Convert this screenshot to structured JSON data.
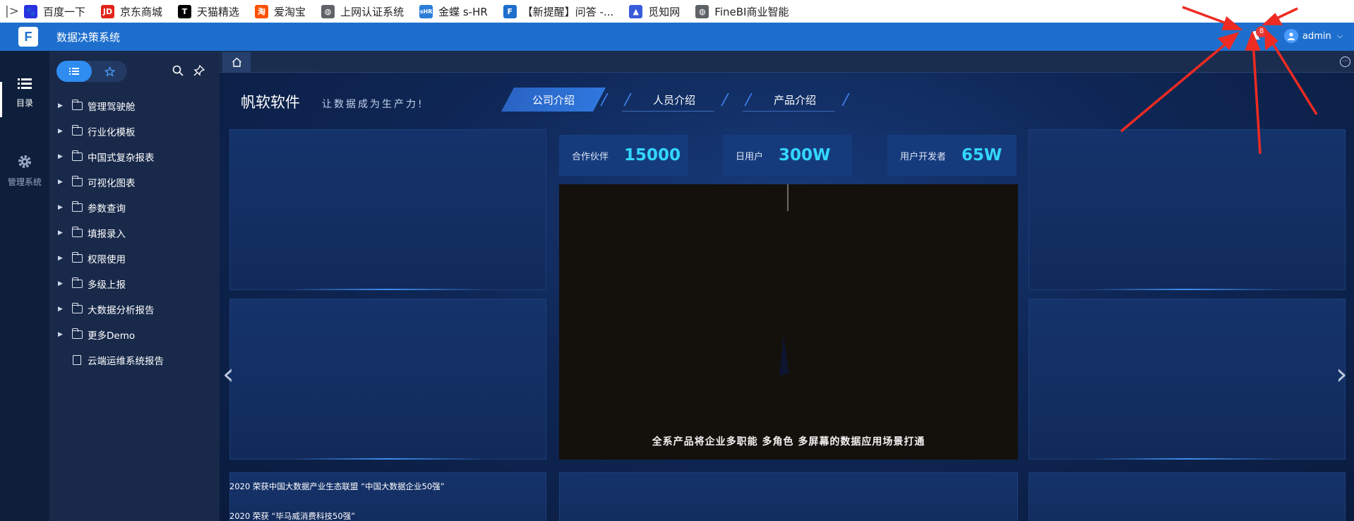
{
  "bookmarks": [
    {
      "label": "百度一下",
      "icon": "baidu-paw-icon",
      "color": "#2932e1",
      "glyph": "🐾"
    },
    {
      "label": "京东商城",
      "icon": "jd-icon",
      "color": "#e1251b",
      "glyph": "JD"
    },
    {
      "label": "天猫精选",
      "icon": "tmall-icon",
      "color": "#000000",
      "glyph": "T"
    },
    {
      "label": "爱淘宝",
      "icon": "taobao-icon",
      "color": "#ff5000",
      "glyph": "淘"
    },
    {
      "label": "上网认证系统",
      "icon": "globe-icon",
      "color": "#5f6368",
      "glyph": "◍"
    },
    {
      "label": "金蝶 s-HR",
      "icon": "kingdee-shr-icon",
      "color": "#2b7dd8",
      "glyph": "sHR"
    },
    {
      "label": "【新提醒】问答 -...",
      "icon": "fanruan-icon",
      "color": "#1e6fcd",
      "glyph": "F"
    },
    {
      "label": "觅知网",
      "icon": "mizhi-icon",
      "color": "#3a5bd9",
      "glyph": "▲"
    },
    {
      "label": "FineBI商业智能",
      "icon": "globe-icon",
      "color": "#5f6368",
      "glyph": "◍"
    }
  ],
  "header": {
    "app_title": "数据决策系统",
    "notification_count": "8",
    "username": "admin",
    "accent": "#1e6fcd"
  },
  "rail": {
    "directory_label": "目录",
    "admin_label": "管理系统"
  },
  "tree": [
    {
      "label": "管理驾驶舱",
      "type": "folder"
    },
    {
      "label": "行业化模板",
      "type": "folder"
    },
    {
      "label": "中国式复杂报表",
      "type": "folder"
    },
    {
      "label": "可视化图表",
      "type": "folder"
    },
    {
      "label": "参数查询",
      "type": "folder"
    },
    {
      "label": "填报录入",
      "type": "folder"
    },
    {
      "label": "权限使用",
      "type": "folder"
    },
    {
      "label": "多级上报",
      "type": "folder"
    },
    {
      "label": "大数据分析报告",
      "type": "folder"
    },
    {
      "label": "更多Demo",
      "type": "folder"
    },
    {
      "label": "云端运维系统报告",
      "type": "file"
    }
  ],
  "dashboard": {
    "brand": "帆软软件",
    "slogan": "让数据成为生产力!",
    "tabs": [
      "公司介绍",
      "人员介绍",
      "产品介绍"
    ],
    "active_tab": "公司介绍",
    "stats": [
      {
        "label": "合作伙伴",
        "value": "15000"
      },
      {
        "label": "日用户",
        "value": "300W"
      },
      {
        "label": "用户开发者",
        "value": "65W"
      }
    ],
    "video_caption": "全系产品将企业多职能 多角色 多屏幕的数据应用场景打通",
    "news": [
      "2020 荣获中国大数据产业生态联盟 “中国大数据企业50强”",
      "2020 荣获 “毕马威消费科技50强”"
    ],
    "stat_value_color": "#33d7ff"
  }
}
